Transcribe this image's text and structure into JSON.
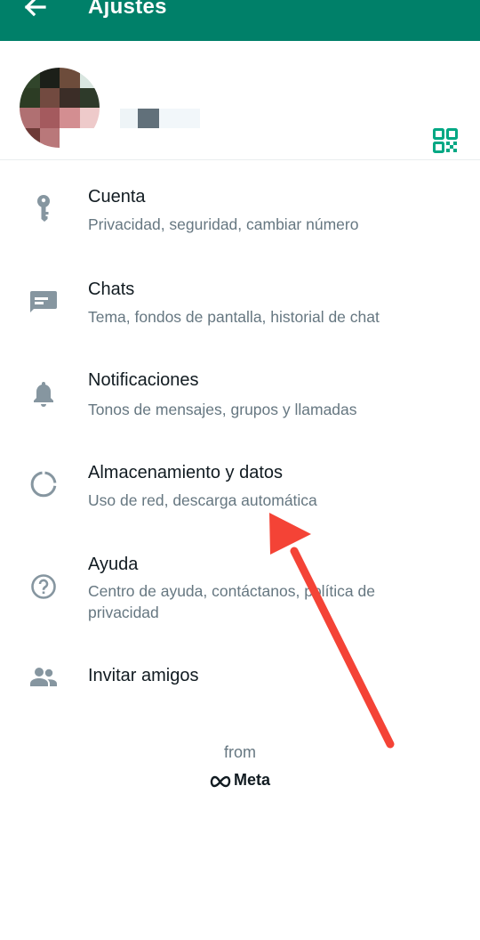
{
  "header": {
    "title": "Ajustes",
    "back_icon": "arrow-left-icon"
  },
  "profile": {
    "qr_icon": "qr-code-icon"
  },
  "menu": {
    "items": [
      {
        "id": "cuenta",
        "icon": "key-icon",
        "label": "Cuenta",
        "sub": "Privacidad, seguridad, cambiar número"
      },
      {
        "id": "chats",
        "icon": "chat-icon",
        "label": "Chats",
        "sub": "Tema, fondos de pantalla, historial de chat"
      },
      {
        "id": "notificaciones",
        "icon": "bell-icon",
        "label": "Notificaciones",
        "sub": "Tonos de mensajes, grupos y llamadas"
      },
      {
        "id": "almacenamiento",
        "icon": "data-usage-icon",
        "label": "Almacenamiento y datos",
        "sub": "Uso de red, descarga automática"
      },
      {
        "id": "ayuda",
        "icon": "help-icon",
        "label": "Ayuda",
        "sub": "Centro de ayuda, contáctanos, política de privacidad"
      },
      {
        "id": "invitar",
        "icon": "people-icon",
        "label": "Invitar amigos"
      }
    ]
  },
  "footer": {
    "from": "from",
    "brand": "Meta"
  },
  "colors": {
    "header": "#008069",
    "icon": "#8696a0",
    "accent": "#00a884",
    "annotation": "#f44336"
  }
}
